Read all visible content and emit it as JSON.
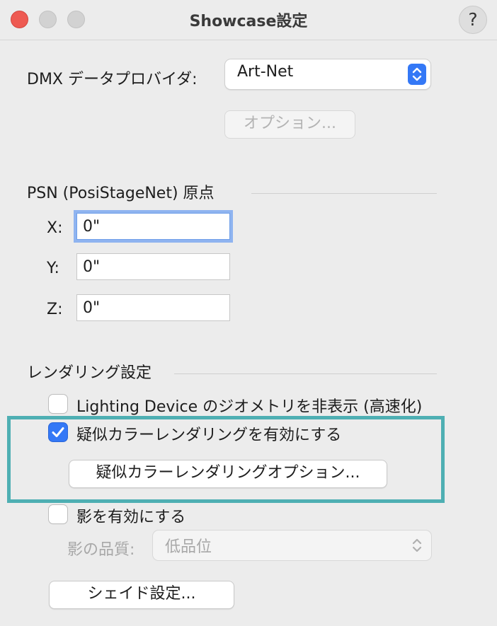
{
  "window": {
    "title": "Showcase設定",
    "help_label": "?"
  },
  "dmx": {
    "label": "DMX データプロバイダ:",
    "provider": "Art-Net",
    "options_button": "オプション..."
  },
  "psn": {
    "header": "PSN (PosiStageNet) 原点",
    "x_label": "X:",
    "x_value": "0\"",
    "y_label": "Y:",
    "y_value": "0\"",
    "z_label": "Z:",
    "z_value": "0\""
  },
  "rendering": {
    "header": "レンダリング設定",
    "hide_geometry_label": "Lighting Device のジオメトリを非表示 (高速化)",
    "hide_geometry_checked": false,
    "pseudo_color_label": "疑似カラーレンダリングを有効にする",
    "pseudo_color_checked": true,
    "pseudo_color_options_button": "疑似カラーレンダリングオプション...",
    "shadows_label": "影を有効にする",
    "shadows_checked": false,
    "shadow_quality_label": "影の品質:",
    "shadow_quality_value": "低品位",
    "shade_settings_button": "シェイド設定..."
  },
  "colors": {
    "accent": "#3478f6",
    "highlight_border": "#4eafb3",
    "close_light": "#ee5a52"
  }
}
